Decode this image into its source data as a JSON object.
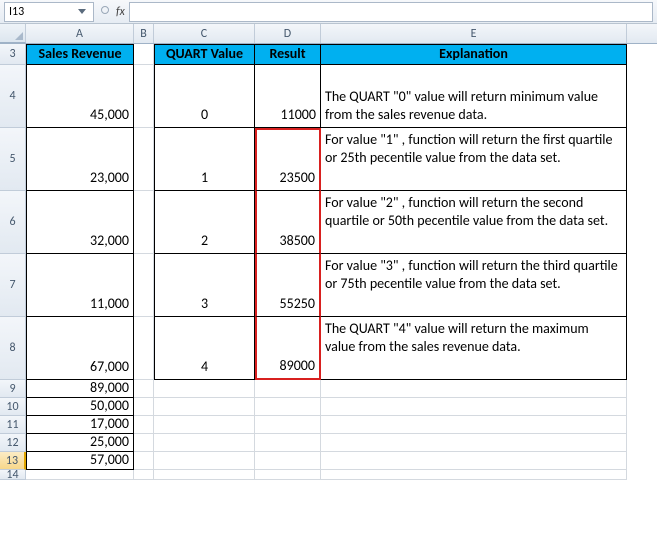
{
  "name_box": "I13",
  "fx_label": "fx",
  "formula_value": "",
  "columns": [
    "A",
    "B",
    "C",
    "D",
    "E"
  ],
  "headers": {
    "A": "Sales Revenue",
    "C": "QUART Value",
    "D": "Result",
    "E": "Explanation"
  },
  "tbl": [
    {
      "row": "4",
      "rev": "45,000",
      "q": "0",
      "res": "11000",
      "exp": "The QUART \"0\" value will return minimum value from the sales revenue data."
    },
    {
      "row": "5",
      "rev": "23,000",
      "q": "1",
      "res": "23500",
      "exp": "For value \"1\" , function will return the first quartile or 25th pecentile value from the data set."
    },
    {
      "row": "6",
      "rev": "32,000",
      "q": "2",
      "res": "38500",
      "exp": "For value \"2\" , function will return the second quartile or 50th pecentile value from the data set."
    },
    {
      "row": "7",
      "rev": "11,000",
      "q": "3",
      "res": "55250",
      "exp": "For value \"3\" , function will return the third quartile or 75th pecentile value from the data set."
    },
    {
      "row": "8",
      "rev": "67,000",
      "q": "4",
      "res": "89000",
      "exp": "The QUART \"4\" value will return the maximum value from the sales revenue data."
    }
  ],
  "extra_rev": [
    {
      "row": "9",
      "v": "89,000"
    },
    {
      "row": "10",
      "v": "50,000"
    },
    {
      "row": "11",
      "v": "17,000"
    },
    {
      "row": "12",
      "v": "25,000"
    },
    {
      "row": "13",
      "v": "57,000"
    }
  ],
  "trailing_row": "14"
}
